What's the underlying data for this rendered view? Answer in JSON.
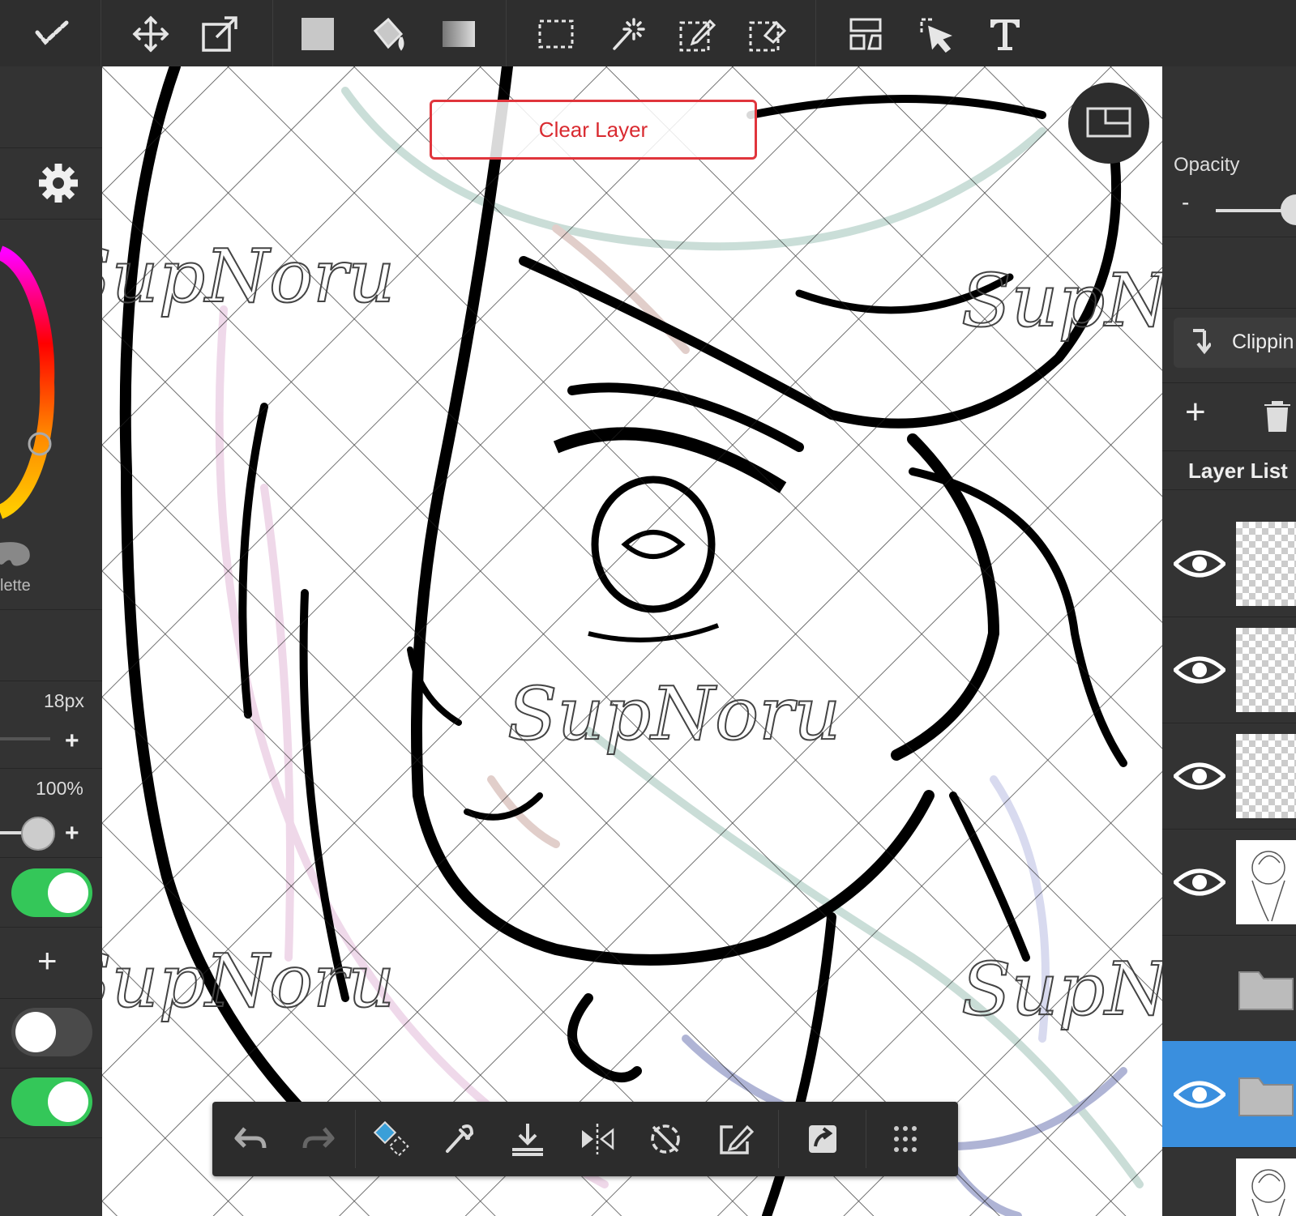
{
  "toolbar": {
    "tools": [
      {
        "name": "brush-tool",
        "icon": "brush-check-icon"
      },
      {
        "name": "move-tool",
        "icon": "move-arrows-icon"
      },
      {
        "name": "transform-tool",
        "icon": "transform-icon"
      },
      {
        "name": "fill-color-tool",
        "icon": "filled-square-icon"
      },
      {
        "name": "bucket-tool",
        "icon": "paint-bucket-icon"
      },
      {
        "name": "gradient-tool",
        "icon": "gradient-square-icon"
      },
      {
        "name": "select-tool",
        "icon": "marquee-select-icon"
      },
      {
        "name": "magic-wand-tool",
        "icon": "magic-wand-icon"
      },
      {
        "name": "select-pen-tool",
        "icon": "select-pen-icon"
      },
      {
        "name": "select-eraser-tool",
        "icon": "select-eraser-icon"
      },
      {
        "name": "frame-divider-tool",
        "icon": "frame-divider-icon"
      },
      {
        "name": "operation-tool",
        "icon": "cursor-select-icon"
      },
      {
        "name": "text-tool",
        "icon": "text-icon"
      }
    ]
  },
  "canvas": {
    "clear_layer_label": "Clear Layer",
    "watermark": "SupNoru"
  },
  "left_panel": {
    "palette_label": "lette",
    "brush_size": "18px",
    "brush_opacity": "100%",
    "toggle_1": true,
    "toggle_2": false,
    "toggle_3": true,
    "colors": {
      "accent": "#34c759",
      "selected_layer": "#3a8fde"
    }
  },
  "right_panel": {
    "opacity_label": "Opacity",
    "opacity_minus": "-",
    "clipping_label": "Clippin",
    "layer_list_label": "Layer List",
    "layers": [
      {
        "visible": true,
        "type": "empty"
      },
      {
        "visible": true,
        "type": "empty"
      },
      {
        "visible": true,
        "type": "empty"
      },
      {
        "visible": true,
        "type": "sketch"
      },
      {
        "visible": false,
        "type": "folder"
      },
      {
        "visible": true,
        "type": "folder",
        "selected": true
      },
      {
        "visible": false,
        "type": "sketch"
      }
    ]
  },
  "bottom_bar": {
    "tools": [
      {
        "name": "undo-button",
        "icon": "undo-icon"
      },
      {
        "name": "redo-button",
        "icon": "redo-icon"
      },
      {
        "name": "color-swap-button",
        "icon": "color-swap-icon"
      },
      {
        "name": "eyedropper-button",
        "icon": "eyedropper-icon"
      },
      {
        "name": "save-button",
        "icon": "download-icon"
      },
      {
        "name": "flip-button",
        "icon": "flip-horizontal-icon"
      },
      {
        "name": "rotate-reset-button",
        "icon": "rotate-disable-icon"
      },
      {
        "name": "edit-button",
        "icon": "edit-square-icon"
      },
      {
        "name": "share-button",
        "icon": "share-icon"
      },
      {
        "name": "menu-button",
        "icon": "grid-dots-icon"
      }
    ]
  }
}
